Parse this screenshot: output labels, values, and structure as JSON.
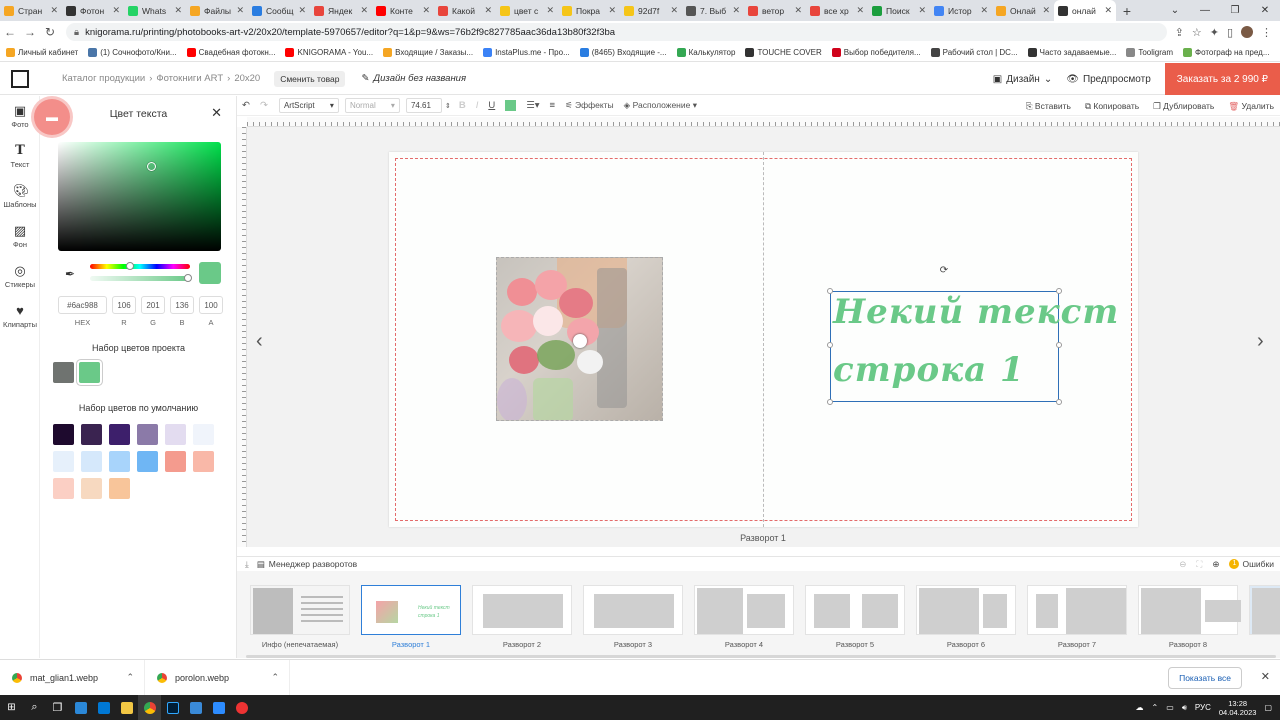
{
  "browser": {
    "tabs": [
      {
        "label": "Стран",
        "color": "#f5a623"
      },
      {
        "label": "Фотон",
        "color": "#333333"
      },
      {
        "label": "Whats",
        "color": "#25d366"
      },
      {
        "label": "Файлы",
        "color": "#f5a623"
      },
      {
        "label": "Сообщ",
        "color": "#2a7de1"
      },
      {
        "label": "Яндек",
        "color": "#e8453c"
      },
      {
        "label": "Конте",
        "color": "#ff0000"
      },
      {
        "label": "Какой",
        "color": "#e8453c"
      },
      {
        "label": "цвет с",
        "color": "#f5c518"
      },
      {
        "label": "Покра",
        "color": "#f5c518"
      },
      {
        "label": "92d7f",
        "color": "#f5c518"
      },
      {
        "label": "7. Выб",
        "color": "#555555"
      },
      {
        "label": "ветор",
        "color": "#e8453c"
      },
      {
        "label": "все хр",
        "color": "#e8453c"
      },
      {
        "label": "Поиск",
        "color": "#1b9e3e"
      },
      {
        "label": "Истор",
        "color": "#4285f4"
      },
      {
        "label": "Онлай",
        "color": "#f5a623"
      },
      {
        "label": "онлай",
        "color": "#333333",
        "active": true
      }
    ],
    "url": "knigorama.ru/printing/photobooks-art-v2/20x20/template-5970657/editor?q=1&p=9&ws=76b2f9c827785aac36da13b80f32f3ba",
    "bookmarks": [
      {
        "label": "Личный кабинет",
        "color": "#f5a623"
      },
      {
        "label": "(1) Сочнофото/Кни...",
        "color": "#4a76a8"
      },
      {
        "label": "Свадебная фотокн...",
        "color": "#ff0000"
      },
      {
        "label": "KNIGORAMA - You...",
        "color": "#ff0000"
      },
      {
        "label": "Входящие / Заказы...",
        "color": "#f5a623"
      },
      {
        "label": "InstaPlus.me - Про...",
        "color": "#3b82f6"
      },
      {
        "label": "(8465) Входящие -...",
        "color": "#2a7de1"
      },
      {
        "label": "Калькулятор",
        "color": "#34a853"
      },
      {
        "label": "TOUCHE COVER",
        "color": "#333333"
      },
      {
        "label": "Выбор победителя...",
        "color": "#d0021b"
      },
      {
        "label": "Рабочий стол | DC...",
        "color": "#444444"
      },
      {
        "label": "Часто задаваемые...",
        "color": "#333333"
      },
      {
        "label": "Tooligram",
        "color": "#888888"
      },
      {
        "label": "Фотограф на пред...",
        "color": "#6ab04c"
      }
    ]
  },
  "app": {
    "breadcrumbs": [
      "Каталог продукции",
      "›",
      "Фотокниги ART",
      "›",
      "20x20"
    ],
    "change_product": "Сменить товар",
    "design_name": "Дизайн без названия",
    "design_menu": "Дизайн",
    "preview": "Предпросмотр",
    "order": "Заказать за 2 990 ₽"
  },
  "sidebar": [
    {
      "label": "Фото",
      "icon": "photo-icon"
    },
    {
      "label": "Текст",
      "icon": "text-icon"
    },
    {
      "label": "Шаблоны",
      "icon": "templates-icon"
    },
    {
      "label": "Фон",
      "icon": "background-icon"
    },
    {
      "label": "Стикеры",
      "icon": "stickers-icon"
    },
    {
      "label": "Клипарты",
      "icon": "cliparts-icon"
    }
  ],
  "color_panel": {
    "title": "Цвет текста",
    "hex": "#6ac988",
    "r": "106",
    "g": "201",
    "b": "136",
    "a": "100",
    "labels": {
      "hex": "HEX",
      "r": "R",
      "g": "G",
      "b": "B",
      "a": "A"
    },
    "current_color": "#6ac988",
    "project_title": "Набор цветов проекта",
    "project_colors": [
      "#6f7370",
      "#6ac988"
    ],
    "default_title": "Набор цветов по умолчанию",
    "default_colors": [
      "#1e0a2e",
      "#3a2350",
      "#3d1f6b",
      "#8b7aa8",
      "#e3dcf0",
      "#f0f4fb",
      "#e6f0fb",
      "#d5e8fb",
      "#a8d4fb",
      "#6fb6f4",
      "#f49b8e",
      "#f9b8a8",
      "#fbcfc4",
      "#f7d9c0",
      "#f8c59a"
    ]
  },
  "toolbar": {
    "font": "ArtScript",
    "style": "Normal",
    "size": "74.61",
    "effects": "Эффекты",
    "arrange": "Расположение",
    "insert": "Вставить",
    "copy": "Копировать",
    "duplicate": "Дублировать",
    "delete": "Удалить"
  },
  "canvas": {
    "text_line1": "Некий текст",
    "text_line2": "строка 1",
    "text_color": "#6ac988",
    "spread_label": "Разворот 1"
  },
  "manager": {
    "title": "Менеджер разворотов",
    "errors": "Ошибки",
    "thumbs": [
      "Инфо (непечатаемая)",
      "Разворот 1",
      "Разворот 2",
      "Разворот 3",
      "Разворот 4",
      "Разворот 5",
      "Разворот 6",
      "Разворот 7",
      "Разворот 8",
      "Раз"
    ]
  },
  "downloads": {
    "files": [
      "mat_glian1.webp",
      "porolon.webp"
    ],
    "show_all": "Показать все"
  },
  "taskbar": {
    "lang": "РУС",
    "time": "13:28",
    "date": "04.04.2023"
  }
}
